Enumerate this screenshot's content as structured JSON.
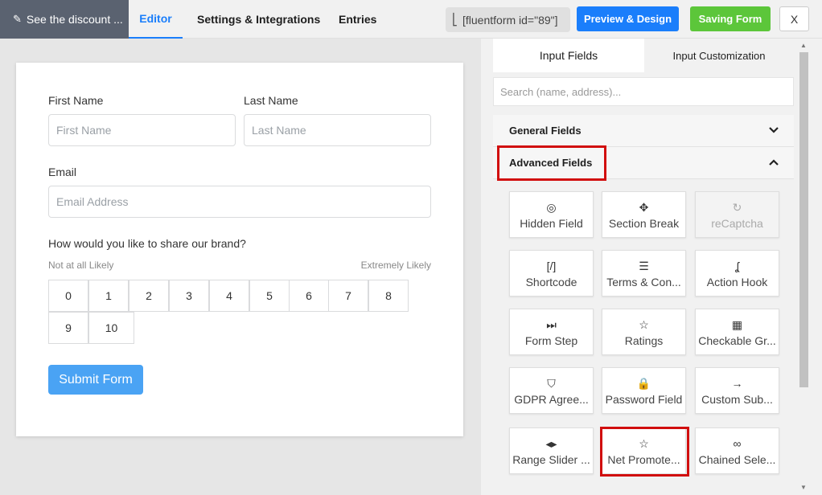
{
  "header": {
    "form_title": "See the discount ...",
    "tabs": [
      "Editor",
      "Settings & Integrations",
      "Entries"
    ],
    "shortcode": "[fluentform id=\"89\"]",
    "preview_label": "Preview & Design",
    "save_label": "Saving Form",
    "close_label": "X"
  },
  "form": {
    "first_name_label": "First Name",
    "first_name_placeholder": "First Name",
    "last_name_label": "Last Name",
    "last_name_placeholder": "Last Name",
    "email_label": "Email",
    "email_placeholder": "Email Address",
    "nps_question": "How would you like to share our brand?",
    "nps_low_label": "Not at all Likely",
    "nps_high_label": "Extremely Likely",
    "nps_options": [
      "0",
      "1",
      "2",
      "3",
      "4",
      "5",
      "6",
      "7",
      "8",
      "9",
      "10"
    ],
    "submit_label": "Submit Form"
  },
  "panel": {
    "tabs": [
      "Input Fields",
      "Input Customization"
    ],
    "search_placeholder": "Search (name, address)...",
    "general_section": "General Fields",
    "advanced_section": "Advanced Fields",
    "advanced_fields": [
      {
        "label": "Hidden Field",
        "icon": "eye-slash-icon",
        "glyph": "◎",
        "disabled": false
      },
      {
        "label": "Section Break",
        "icon": "puzzle-icon",
        "glyph": "✥",
        "disabled": false
      },
      {
        "label": "reCaptcha",
        "icon": "recaptcha-icon",
        "glyph": "↻",
        "disabled": true
      },
      {
        "label": "Shortcode",
        "icon": "shortcode-icon",
        "glyph": "[/]",
        "disabled": false
      },
      {
        "label": "Terms & Con...",
        "icon": "document-icon",
        "glyph": "☰",
        "disabled": false
      },
      {
        "label": "Action Hook",
        "icon": "hook-icon",
        "glyph": "ʆ",
        "disabled": false
      },
      {
        "label": "Form Step",
        "icon": "step-forward-icon",
        "glyph": "⏭",
        "disabled": false
      },
      {
        "label": "Ratings",
        "icon": "star-icon",
        "glyph": "☆",
        "disabled": false
      },
      {
        "label": "Checkable Gr...",
        "icon": "checkable-grid-icon",
        "glyph": "▦",
        "disabled": false
      },
      {
        "label": "GDPR Agree...",
        "icon": "shield-icon",
        "glyph": "⛉",
        "disabled": false
      },
      {
        "label": "Password Field",
        "icon": "lock-icon",
        "glyph": "🔒",
        "disabled": false
      },
      {
        "label": "Custom Sub...",
        "icon": "arrow-right-icon",
        "glyph": "→",
        "disabled": false
      },
      {
        "label": "Range Slider ...",
        "icon": "range-arrows-icon",
        "glyph": "◂▸",
        "disabled": false
      },
      {
        "label": "Net Promote...",
        "icon": "star-icon",
        "glyph": "☆",
        "disabled": false
      },
      {
        "label": "Chained Sele...",
        "icon": "link-icon",
        "glyph": "∞",
        "disabled": false
      }
    ]
  },
  "colors": {
    "accent": "#1a7efb",
    "save_green": "#5cc63a",
    "highlight_red": "#d10e0e",
    "submit_blue": "#4aa3f4"
  }
}
